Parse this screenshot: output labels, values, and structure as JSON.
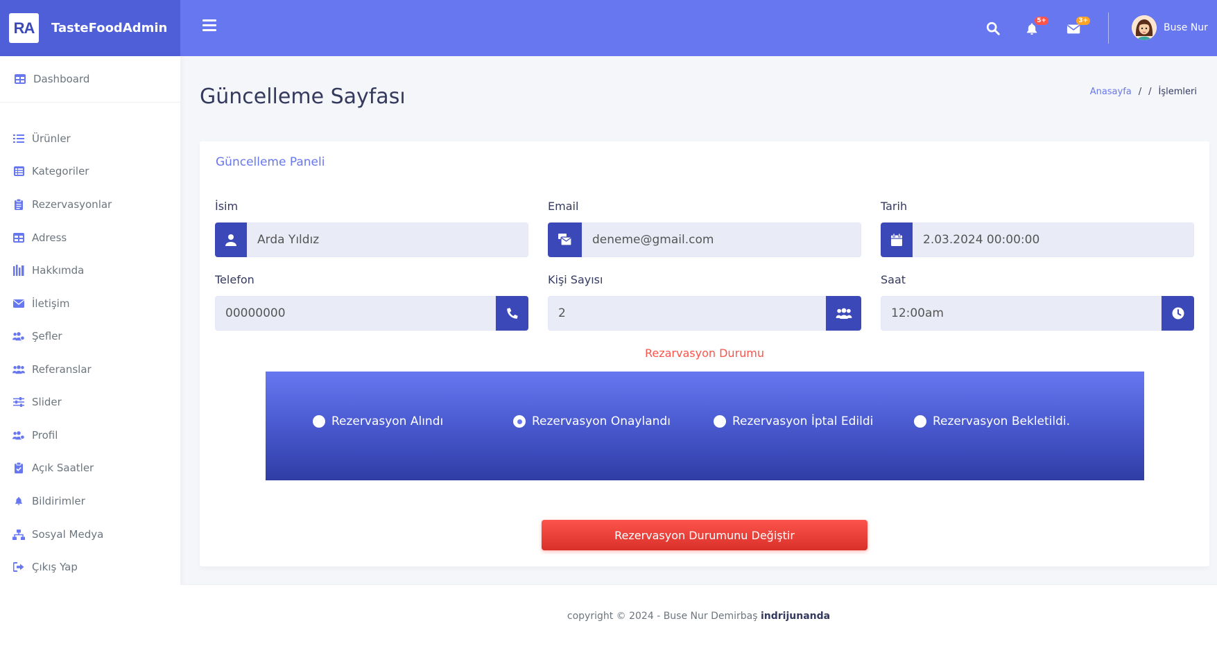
{
  "brand": {
    "logo": "RA",
    "name": "TasteFoodAdmin"
  },
  "topbar": {
    "notifications_badge": "5+",
    "messages_badge": "3+",
    "user_name": "Buse Nur"
  },
  "sidebar": {
    "dashboard": "Dashboard",
    "items": [
      {
        "label": "Ürünler",
        "icon": "list-icon"
      },
      {
        "label": "Kategoriler",
        "icon": "table-list-icon"
      },
      {
        "label": "Rezervasyonlar",
        "icon": "clipboard-icon"
      },
      {
        "label": "Adress",
        "icon": "table-icon"
      },
      {
        "label": "Hakkımda",
        "icon": "bars-icon"
      },
      {
        "label": "İletişim",
        "icon": "envelope-icon"
      },
      {
        "label": "Şefler",
        "icon": "users-cog-icon"
      },
      {
        "label": "Referanslar",
        "icon": "users-icon"
      },
      {
        "label": "Slider",
        "icon": "sliders-icon"
      },
      {
        "label": "Profil",
        "icon": "user-cog-icon"
      },
      {
        "label": "Açık Saatler",
        "icon": "clipboard-check-icon"
      },
      {
        "label": "Bildirimler",
        "icon": "bell-icon"
      },
      {
        "label": "Sosyal Medya",
        "icon": "sitemap-icon"
      },
      {
        "label": "Çıkış Yap",
        "icon": "sign-out-icon"
      }
    ]
  },
  "page": {
    "title": "Güncelleme Sayfası",
    "breadcrumb": {
      "home": "Anasayfa",
      "sep": "/",
      "current": "İşlemleri"
    }
  },
  "card": {
    "header": "Güncelleme Paneli",
    "fields": {
      "isim": {
        "label": "İsim",
        "value": "Arda Yıldız"
      },
      "email": {
        "label": "Email",
        "value": "deneme@gmail.com"
      },
      "tarih": {
        "label": "Tarih",
        "value": "2.03.2024 00:00:00"
      },
      "telefon": {
        "label": "Telefon",
        "value": "00000000"
      },
      "kisi": {
        "label": "Kişi Sayısı",
        "value": "2"
      },
      "saat": {
        "label": "Saat",
        "value": "12:00am"
      }
    },
    "status_title": "Rezarvasyon Durumu",
    "status_options": [
      {
        "label": "Rezervasyon Alındı",
        "checked": false
      },
      {
        "label": "Rezervasyon Onaylandı",
        "checked": true
      },
      {
        "label": "Rezervasyon İptal Edildi",
        "checked": false
      },
      {
        "label": "Rezervasyon Bekletildi.",
        "checked": false
      }
    ],
    "submit_label": "Rezervasyon Durumunu Değiştir"
  },
  "footer": {
    "text": "copyright © 2024 - Buse Nur Demirbaş",
    "author": "indrijunanda"
  },
  "colors": {
    "primary": "#6777ef",
    "primary_dark": "#3b49b8",
    "danger": "#fc544b"
  }
}
